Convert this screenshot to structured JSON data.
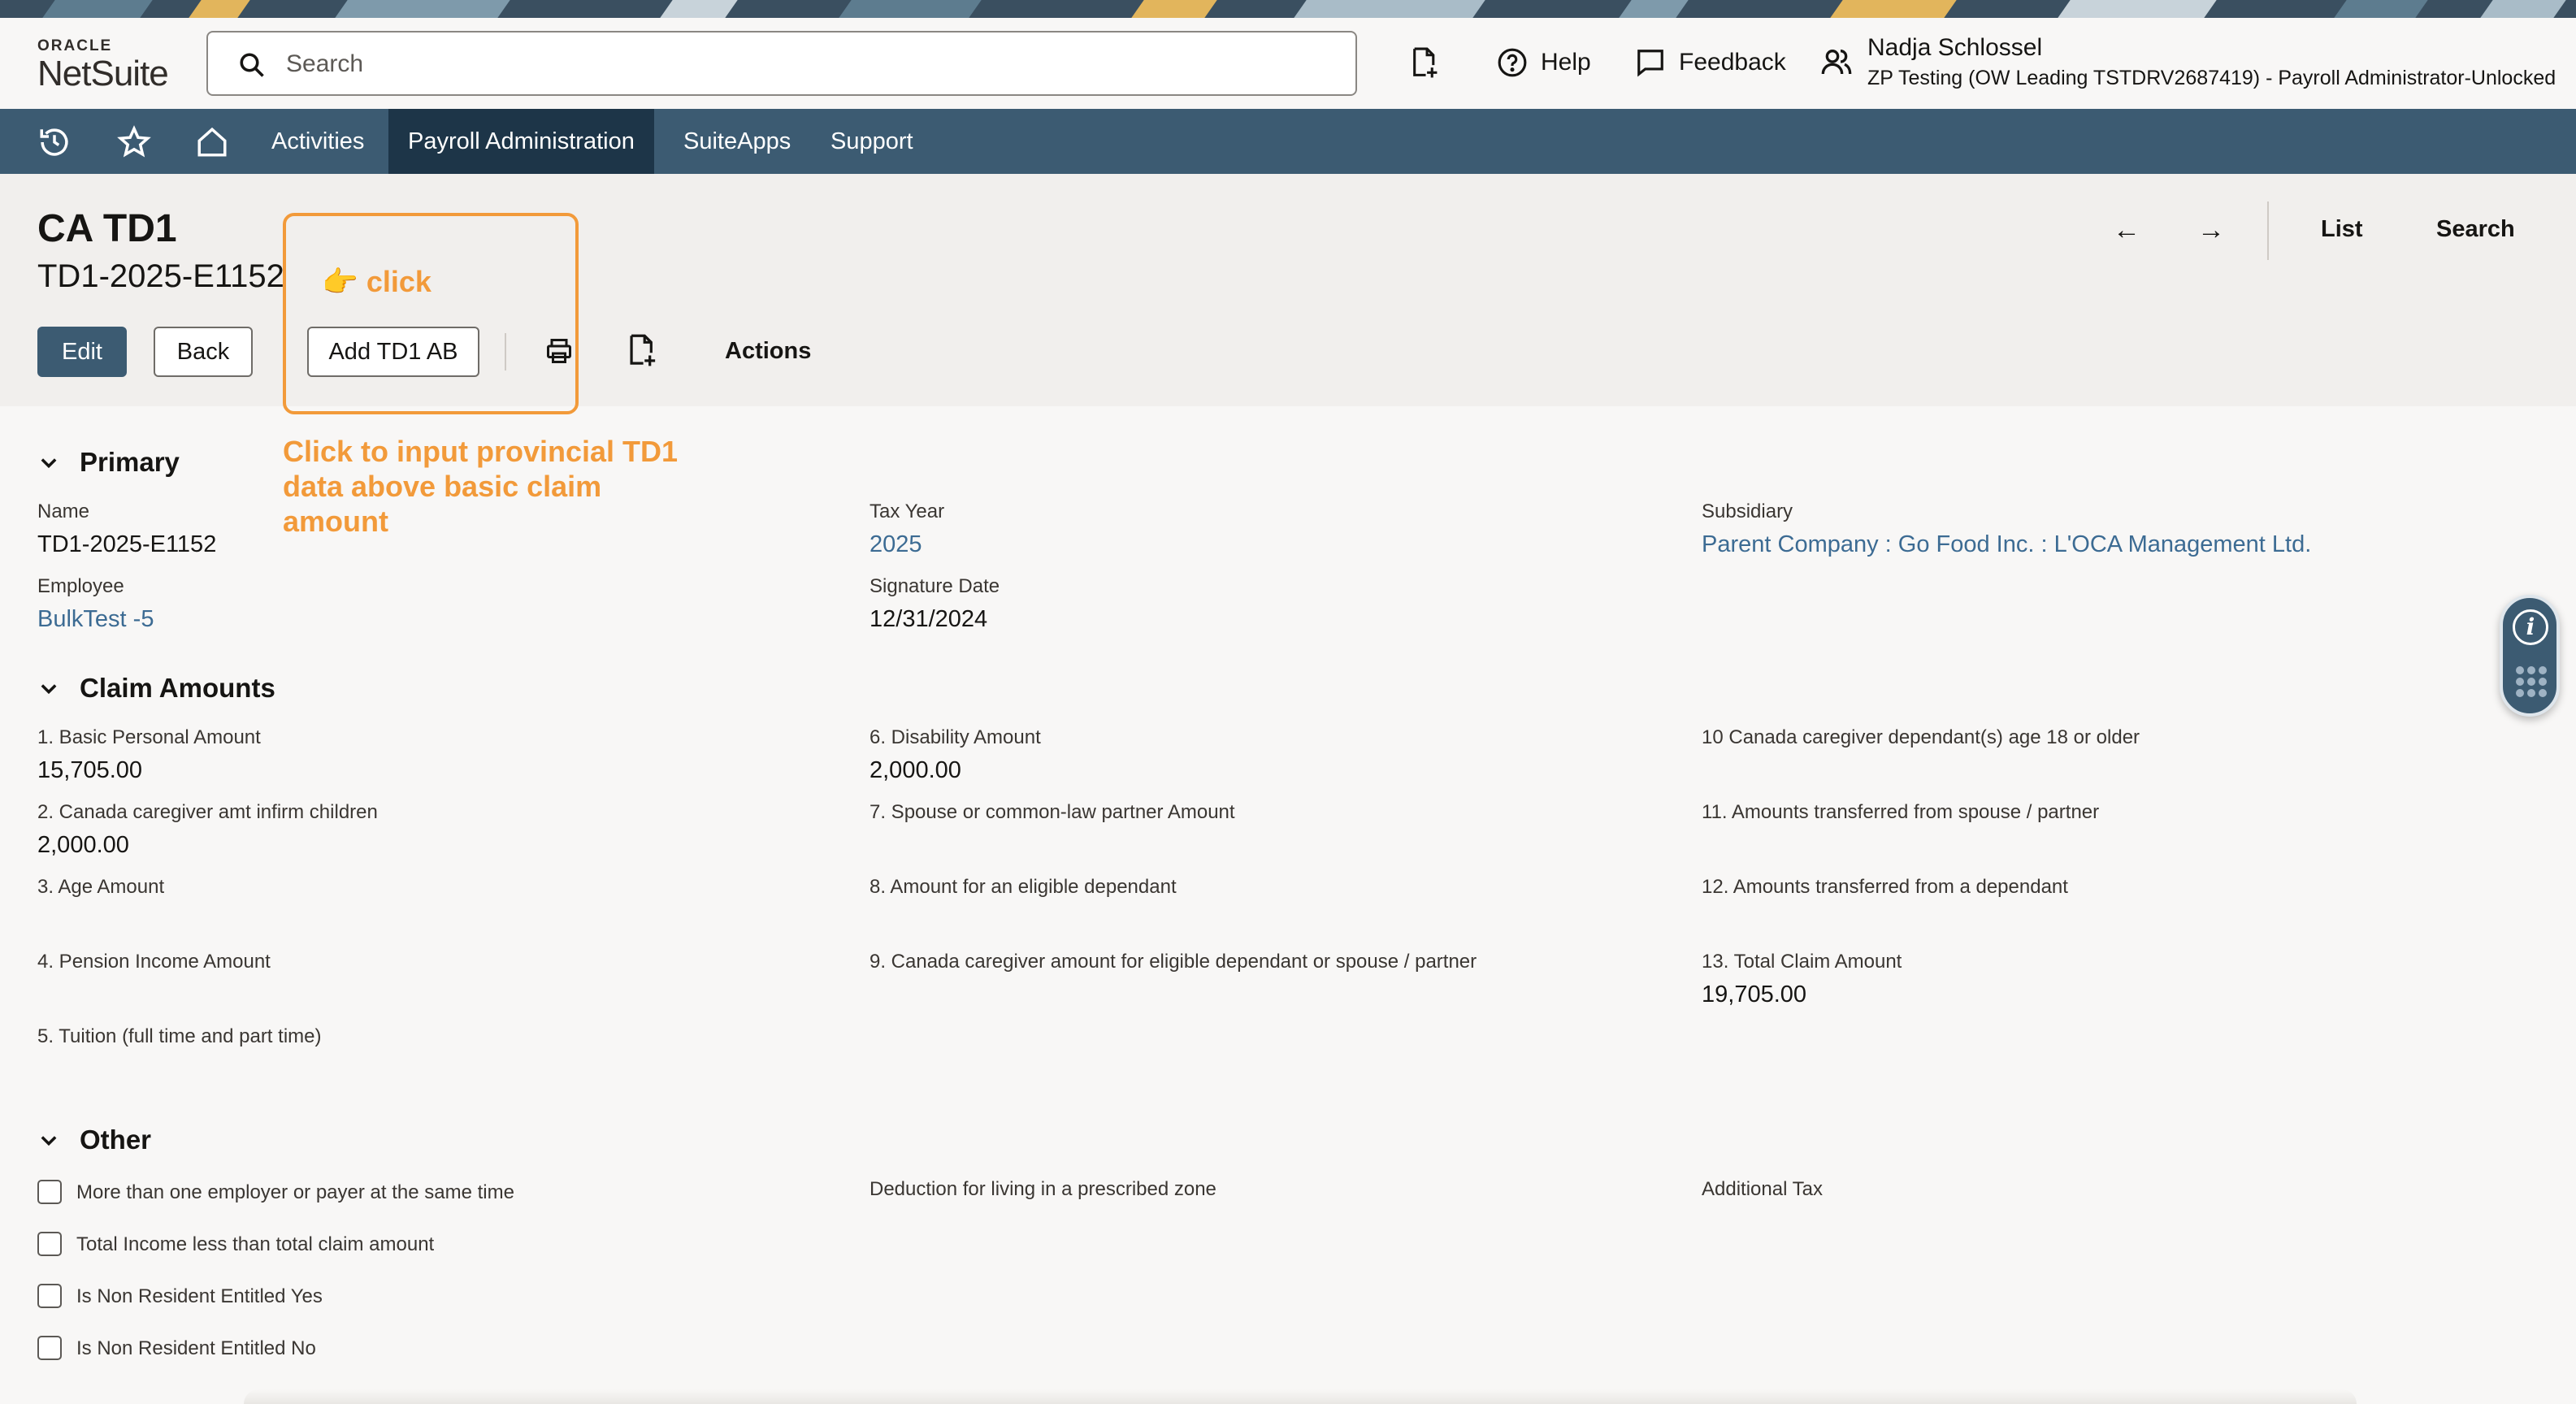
{
  "header": {
    "logo_top": "ORACLE",
    "logo_bottom": "NetSuite",
    "search_placeholder": "Search",
    "create_icon": "new-record-icon",
    "help_label": "Help",
    "feedback_label": "Feedback",
    "user_name": "Nadja Schlossel",
    "user_role": "ZP Testing (OW Leading TSTDRV2687419) - Payroll Administrator-Unlocked"
  },
  "nav": {
    "icons": [
      "history-icon",
      "star-icon",
      "home-icon"
    ],
    "tabs": [
      {
        "label": "Activities"
      },
      {
        "label": "Payroll Administration"
      },
      {
        "label": "SuiteApps"
      },
      {
        "label": "Support"
      }
    ]
  },
  "record": {
    "type_title": "CA TD1",
    "record_id": "TD1-2025-E1152",
    "buttons": {
      "edit": "Edit",
      "back": "Back",
      "add_td1_ab": "Add TD1 AB",
      "actions": "Actions"
    },
    "nav_prev": "←",
    "nav_next": "→",
    "list_label": "List",
    "search_label": "Search"
  },
  "annotation": {
    "click_label": "👉 click",
    "note": "Click to input provincial TD1 data above basic claim amount",
    "color": "#f29a3a"
  },
  "sections": {
    "primary": {
      "title": "Primary",
      "name_label": "Name",
      "name_value": "TD1-2025-E1152",
      "employee_label": "Employee",
      "employee_value": "BulkTest -5",
      "tax_year_label": "Tax Year",
      "tax_year_value": "2025",
      "signature_date_label": "Signature Date",
      "signature_date_value": "12/31/2024",
      "subsidiary_label": "Subsidiary",
      "subsidiary_value": "Parent Company : Go Food Inc. : L'OCA Management Ltd."
    },
    "claim": {
      "title": "Claim Amounts",
      "f1_label": "1. Basic Personal Amount",
      "f1_value": "15,705.00",
      "f2_label": "2. Canada caregiver amt infirm children",
      "f2_value": "2,000.00",
      "f3_label": "3. Age Amount",
      "f4_label": "4. Pension Income Amount",
      "f5_label": "5. Tuition (full time and part time)",
      "f6_label": "6. Disability Amount",
      "f6_value": "2,000.00",
      "f7_label": "7. Spouse or common-law partner Amount",
      "f8_label": "8. Amount for an eligible dependant",
      "f9_label": "9. Canada caregiver amount for eligible dependant or spouse / partner",
      "f10_label": "10 Canada caregiver dependant(s) age 18 or older",
      "f11_label": "11. Amounts transferred from spouse / partner",
      "f12_label": "12. Amounts transferred from a dependant",
      "f13_label": "13. Total Claim Amount",
      "f13_value": "19,705.00"
    },
    "other": {
      "title": "Other",
      "cb1": "More than one employer or payer at the same time",
      "cb2": "Total Income less than total claim amount",
      "cb3": "Is Non Resident Entitled Yes",
      "cb4": "Is Non Resident Entitled No",
      "prescribed_zone_label": "Deduction for living in a prescribed zone",
      "additional_tax_label": "Additional Tax"
    }
  },
  "colors": {
    "nav_bg": "#3c5b72",
    "nav_active_bg": "#1d3548",
    "link": "#3c6b93",
    "primary_button": "#3c5b72"
  }
}
